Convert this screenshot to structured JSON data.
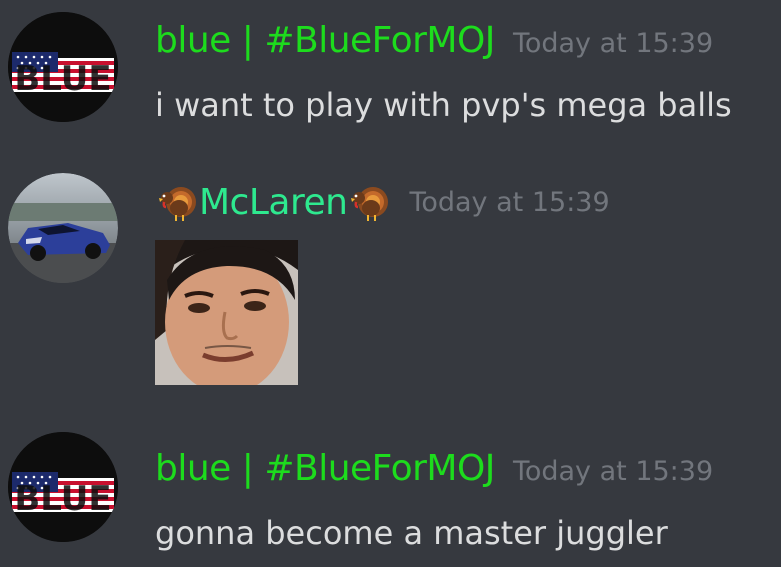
{
  "messages": [
    {
      "username": "blue | #BlueForMOJ",
      "timestamp": "Today at 15:39",
      "text": "i want to play with pvp's mega balls",
      "avatar_text": "BLUE"
    },
    {
      "username": "McLaren",
      "timestamp": "Today at 15:39",
      "emoji_left": "turkey-emoji",
      "emoji_right": "turkey-emoji",
      "attachment": "face-image"
    },
    {
      "username": "blue | #BlueForMOJ",
      "timestamp": "Today at 15:39",
      "text": "gonna become a master juggler",
      "avatar_text": "BLUE"
    }
  ],
  "colors": {
    "background": "#36393f",
    "username_blue": "#1ddc1d",
    "username_mclaren": "#2ee98f",
    "timestamp": "#72767d",
    "message_text": "#dcddde"
  }
}
